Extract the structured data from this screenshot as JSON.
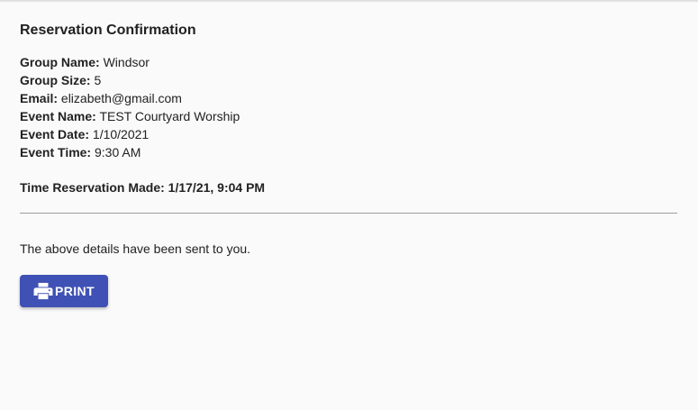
{
  "page": {
    "title": "Reservation Confirmation"
  },
  "details": [
    {
      "label": "Group Name:",
      "value": " Windsor"
    },
    {
      "label": "Group Size:",
      "value": " 5"
    },
    {
      "label": "Email:",
      "value": " elizabeth@gmail.com"
    },
    {
      "label": "Event Name:",
      "value": " TEST Courtyard Worship"
    },
    {
      "label": "Event Date:",
      "value": " 1/10/2021"
    },
    {
      "label": "Event Time:",
      "value": " 9:30 AM"
    }
  ],
  "reservation_made": "Time Reservation Made: 1/17/21, 9:04 PM",
  "sent_message": "The above details have been sent to you.",
  "print_button": {
    "label": "PRINT",
    "icon": "print-icon",
    "color": "#3f51b5"
  }
}
